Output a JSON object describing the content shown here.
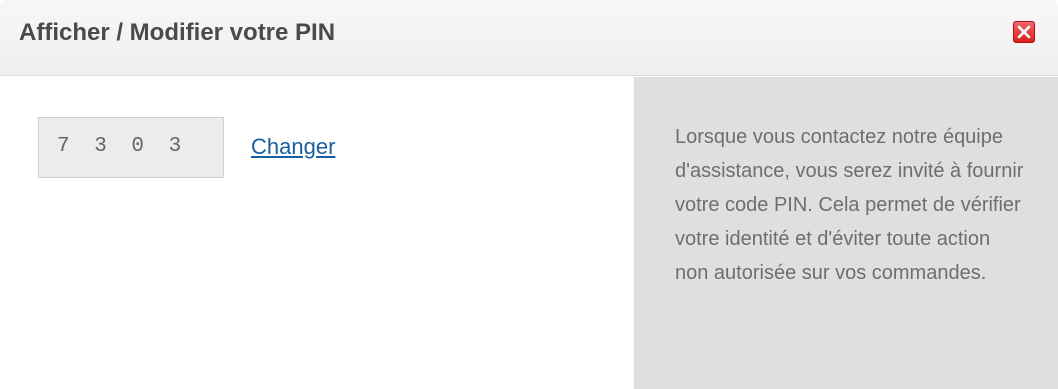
{
  "dialog": {
    "title": "Afficher / Modifier votre PIN",
    "close_icon": "close-icon",
    "accent_close": "#d71f1f"
  },
  "pin": {
    "value": "7303",
    "display": "7 3 0 3",
    "change_label": "Changer",
    "link_color": "#1a5fa0"
  },
  "info": {
    "text": "Lorsque vous contactez notre équipe d'assistance, vous serez invité à fournir votre code PIN. Cela permet de vérifier votre identité et d'éviter toute action non autorisée sur vos commandes.",
    "panel_color": "#dfdfdf"
  }
}
